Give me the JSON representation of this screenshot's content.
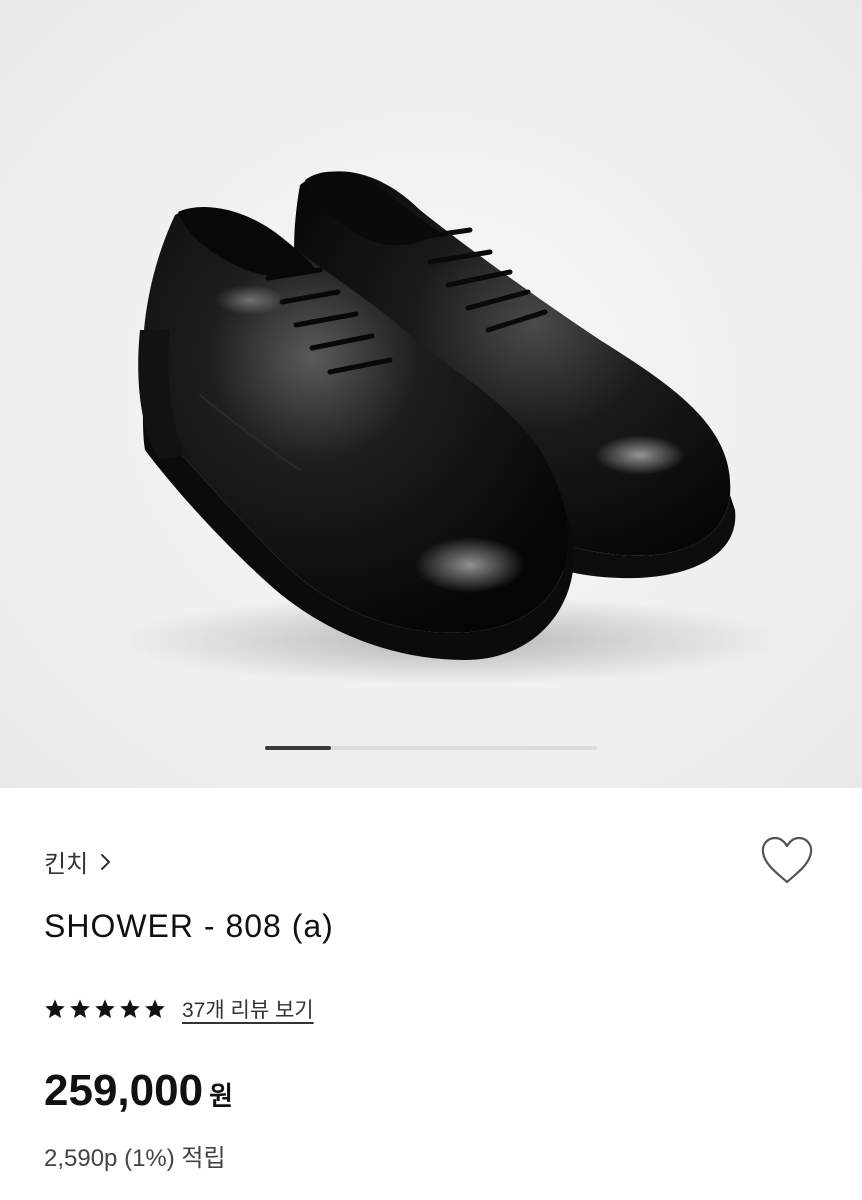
{
  "gallery": {
    "image_alt": "black leather derby shoes",
    "slide_indicator": {
      "current": 1,
      "total": 5
    }
  },
  "product": {
    "brand": "킨치",
    "title": "SHOWER - 808 (a)",
    "rating": {
      "stars": 5,
      "review_link": "37개 리뷰 보기"
    },
    "price": {
      "value": "259,000",
      "unit": "원"
    },
    "points": "2,590p (1%) 적립"
  },
  "icons": {
    "brand_chevron": "chevron-right-icon",
    "wishlist": "heart-outline-icon",
    "star": "star-filled-icon"
  },
  "colors": {
    "text_primary": "#111111",
    "text_secondary": "#444444",
    "indicator_active": "#3a3a3a",
    "indicator_track": "#dcdcdc"
  }
}
